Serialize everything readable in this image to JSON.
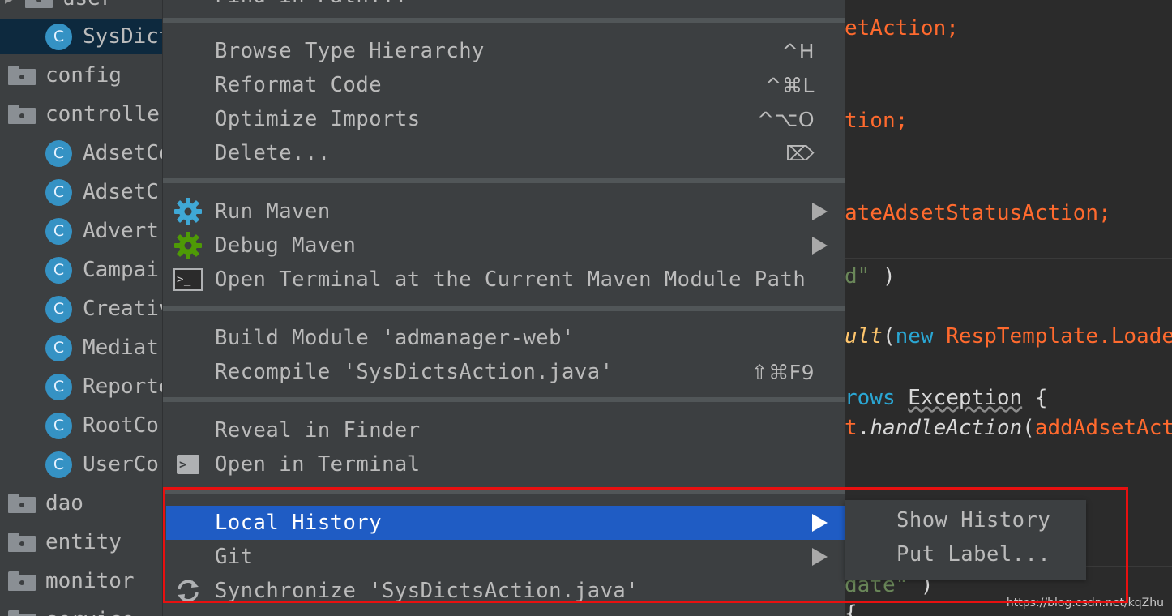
{
  "project_tree": {
    "items": [
      {
        "type": "folder",
        "label": "user",
        "partial": true,
        "arrow": "▶"
      },
      {
        "type": "class",
        "label": "SysDict",
        "selected": true
      },
      {
        "type": "folder",
        "label": "config"
      },
      {
        "type": "folder",
        "label": "controlle"
      },
      {
        "type": "class",
        "label": "AdsetCo"
      },
      {
        "type": "class",
        "label": "AdsetC"
      },
      {
        "type": "class",
        "label": "Advert"
      },
      {
        "type": "class",
        "label": "Campai"
      },
      {
        "type": "class",
        "label": "Creativ"
      },
      {
        "type": "class",
        "label": "Mediat"
      },
      {
        "type": "class",
        "label": "Reporte"
      },
      {
        "type": "class",
        "label": "RootCo"
      },
      {
        "type": "class",
        "label": "UserCo"
      },
      {
        "type": "folder",
        "label": "dao"
      },
      {
        "type": "folder",
        "label": "entity"
      },
      {
        "type": "folder",
        "label": "monitor"
      },
      {
        "type": "folder",
        "label": "service",
        "partial": true
      }
    ],
    "class_icon_letter": "C"
  },
  "editor": {
    "lines": [
      {
        "parts": [
          {
            "t": "etAction",
            "c": "orange"
          },
          {
            "t": ";",
            "c": "orange"
          }
        ]
      },
      {
        "parts": [
          {
            "t": "tion",
            "c": "orange"
          },
          {
            "t": ";",
            "c": "orange"
          }
        ]
      },
      {
        "parts": [
          {
            "t": "ateAdsetStatusAction",
            "c": "orange"
          },
          {
            "t": ";",
            "c": "orange"
          }
        ]
      },
      {
        "parts": [
          {
            "t": "d\"",
            "c": "green"
          },
          {
            "t": " )",
            "c": "white"
          }
        ]
      },
      {
        "parts": [
          {
            "t": "ult",
            "c": "yellow",
            "i": true
          },
          {
            "t": "(",
            "c": "white"
          },
          {
            "t": "new ",
            "c": "blue"
          },
          {
            "t": "RespTemplate",
            "c": "orange"
          },
          {
            "t": ".Loade",
            "c": "orange"
          }
        ]
      },
      {
        "parts": [
          {
            "t": "rows ",
            "c": "blue"
          },
          {
            "t": "Exception",
            "c": "white",
            "u": true
          },
          {
            "t": " {",
            "c": "white"
          }
        ]
      },
      {
        "parts": [
          {
            "t": "t",
            "c": "orange"
          },
          {
            "t": ".",
            "c": "white"
          },
          {
            "t": "handleAction",
            "c": "white",
            "i": true
          },
          {
            "t": "(",
            "c": "white"
          },
          {
            "t": "addAdsetAct",
            "c": "orange"
          }
        ]
      },
      {
        "parts": [
          {
            "t": "date\"",
            "c": "green"
          },
          {
            "t": " )",
            "c": "white"
          }
        ]
      },
      {
        "parts": [
          {
            "t": "{",
            "c": "white"
          }
        ]
      }
    ],
    "watermark": "https://blog.csdn.net/kqZhu"
  },
  "context_menu": {
    "top_partial_label": "Find in Path...",
    "groups": [
      [
        {
          "label": "Browse Type Hierarchy",
          "shortcut": "^H"
        },
        {
          "label": "Reformat Code",
          "shortcut": "^⌘L"
        },
        {
          "label": "Optimize Imports",
          "shortcut": "^⌥O"
        },
        {
          "label": "Delete...",
          "shortcut": "⌦"
        }
      ],
      [
        {
          "label": "Run Maven",
          "icon": "maven-run-icon",
          "submenu": true,
          "icon_color": "#3fa8d6"
        },
        {
          "label": "Debug Maven",
          "icon": "maven-debug-icon",
          "submenu": true,
          "icon_color": "#4e9a06"
        },
        {
          "label": "Open Terminal at the Current Maven Module Path",
          "icon": "terminal-icon"
        }
      ],
      [
        {
          "label": "Build Module 'admanager-web'"
        },
        {
          "label": "Recompile 'SysDictsAction.java'",
          "shortcut": "⇧⌘F9"
        }
      ],
      [
        {
          "label": "Reveal in Finder"
        },
        {
          "label": "Open in Terminal",
          "icon": "terminal-solid-icon"
        }
      ],
      [
        {
          "label": "Local History",
          "submenu": true,
          "highlighted": true
        },
        {
          "label": "Git",
          "submenu": true
        },
        {
          "label": "Synchronize 'SysDictsAction.java'",
          "icon": "sync-icon"
        }
      ]
    ]
  },
  "submenu": {
    "items": [
      {
        "label": "Show History"
      },
      {
        "label": "Put Label..."
      }
    ]
  },
  "colors": {
    "accent_selection": "#1f5cc4",
    "annotation_box": "#e81010"
  }
}
